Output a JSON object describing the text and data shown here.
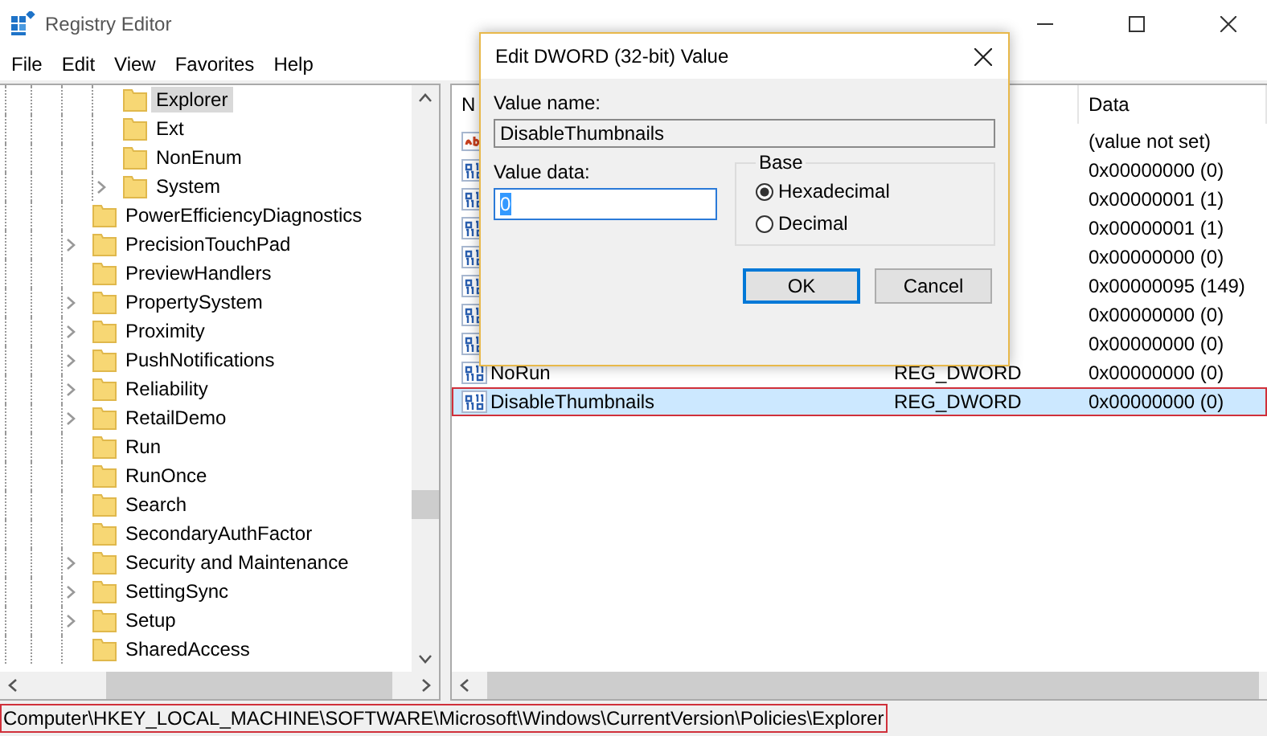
{
  "window": {
    "title": "Registry Editor"
  },
  "menu": [
    "File",
    "Edit",
    "View",
    "Favorites",
    "Help"
  ],
  "tree": {
    "items": [
      {
        "children": [
          {
            "label": "Explorer",
            "expandable": false,
            "selected": true
          },
          {
            "label": "Ext",
            "expandable": false,
            "selected": false
          },
          {
            "label": "NonEnum",
            "expandable": false,
            "selected": false
          },
          {
            "label": "System",
            "expandable": true,
            "selected": false
          }
        ]
      },
      {
        "label": "PowerEfficiencyDiagnostics",
        "expandable": false,
        "selected": false
      },
      {
        "label": "PrecisionTouchPad",
        "expandable": true,
        "selected": false
      },
      {
        "label": "PreviewHandlers",
        "expandable": false,
        "selected": false
      },
      {
        "label": "PropertySystem",
        "expandable": true,
        "selected": false
      },
      {
        "label": "Proximity",
        "expandable": true,
        "selected": false
      },
      {
        "label": "PushNotifications",
        "expandable": true,
        "selected": false
      },
      {
        "label": "Reliability",
        "expandable": true,
        "selected": false
      },
      {
        "label": "RetailDemo",
        "expandable": true,
        "selected": false
      },
      {
        "label": "Run",
        "expandable": false,
        "selected": false
      },
      {
        "label": "RunOnce",
        "expandable": false,
        "selected": false
      },
      {
        "label": "Search",
        "expandable": false,
        "selected": false
      },
      {
        "label": "SecondaryAuthFactor",
        "expandable": false,
        "selected": false
      },
      {
        "label": "Security and Maintenance",
        "expandable": true,
        "selected": false
      },
      {
        "label": "SettingSync",
        "expandable": true,
        "selected": false
      },
      {
        "label": "Setup",
        "expandable": true,
        "selected": false
      },
      {
        "label": "SharedAccess",
        "expandable": false,
        "selected": false
      }
    ]
  },
  "values": {
    "columns": [
      "N",
      "Data"
    ],
    "rows": [
      {
        "kind": "string",
        "data": "(value not set)",
        "selected": false
      },
      {
        "kind": "dword",
        "data": "0x00000000 (0)",
        "selected": false
      },
      {
        "kind": "dword",
        "data": "0x00000001 (1)",
        "selected": false
      },
      {
        "kind": "dword",
        "data": "0x00000001 (1)",
        "selected": false
      },
      {
        "kind": "dword",
        "data": "0x00000000 (0)",
        "selected": false
      },
      {
        "kind": "dword",
        "data": "0x00000095 (149)",
        "selected": false
      },
      {
        "kind": "dword",
        "data": "0x00000000 (0)",
        "selected": false
      },
      {
        "kind": "dword",
        "data": "0x00000000 (0)",
        "selected": false
      },
      {
        "kind": "dword",
        "name": "NoRun",
        "type": "REG_DWORD",
        "data": "0x00000000 (0)",
        "selected": false
      },
      {
        "kind": "dword",
        "name": "DisableThumbnails",
        "type": "REG_DWORD",
        "data": "0x00000000 (0)",
        "selected": true
      }
    ]
  },
  "status_bar": "Computer\\HKEY_LOCAL_MACHINE\\SOFTWARE\\Microsoft\\Windows\\CurrentVersion\\Policies\\Explorer",
  "dialog": {
    "title": "Edit DWORD (32-bit) Value",
    "value_name_label": "Value name:",
    "value_name": "DisableThumbnails",
    "value_data_label": "Value data:",
    "value_data": "0",
    "base_label": "Base",
    "bases": [
      {
        "label": "Hexadecimal",
        "selected": true
      },
      {
        "label": "Decimal",
        "selected": false
      }
    ],
    "buttons": [
      "OK",
      "Cancel"
    ]
  }
}
